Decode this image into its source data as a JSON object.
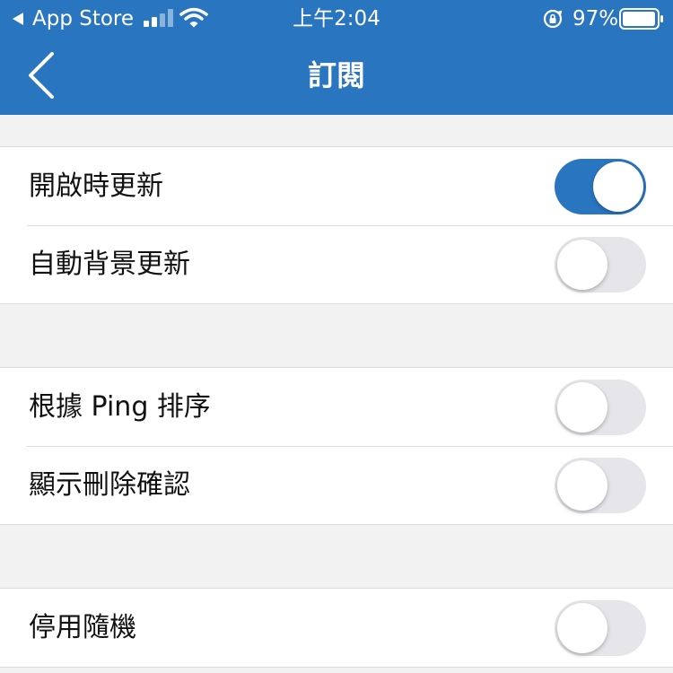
{
  "status_bar": {
    "back_app": "App Store",
    "time": "上午2:04",
    "battery_percent": "97%",
    "signal_bars_active": 2,
    "signal_bars_total": 4,
    "battery_level": 0.97
  },
  "nav": {
    "title": "訂閱",
    "back_icon": "chevron-left-icon"
  },
  "sections": [
    {
      "rows": [
        {
          "label": "開啟時更新",
          "enabled": true
        },
        {
          "label": "自動背景更新",
          "enabled": false
        }
      ]
    },
    {
      "rows": [
        {
          "label": "根據 Ping 排序",
          "enabled": false
        },
        {
          "label": "顯示刪除確認",
          "enabled": false
        }
      ]
    },
    {
      "rows": [
        {
          "label": "停用隨機",
          "enabled": false
        }
      ]
    }
  ],
  "colors": {
    "accent": "#2a75bf",
    "toggle_off": "#e5e5ea",
    "background": "#f2f2f2"
  }
}
